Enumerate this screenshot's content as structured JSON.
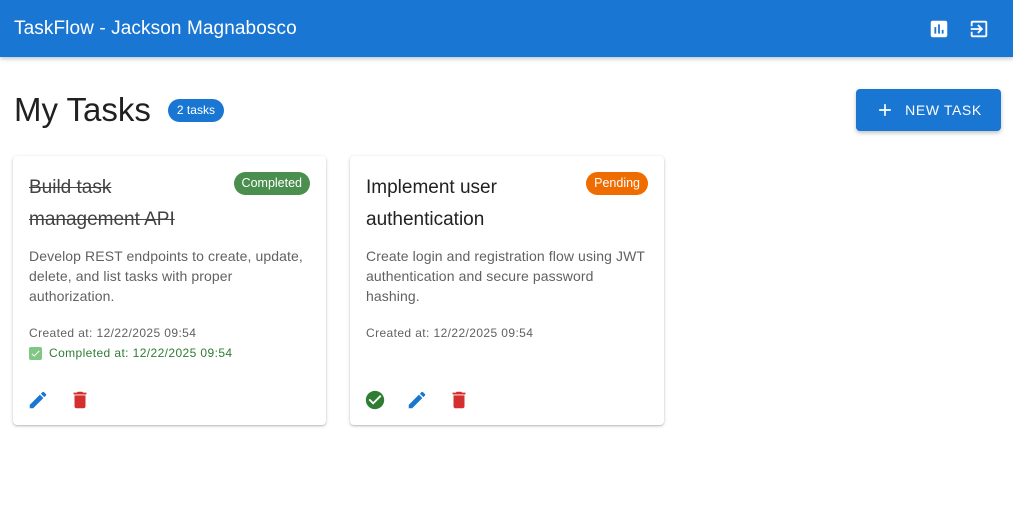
{
  "appbar": {
    "title": "TaskFlow - Jackson Magnabosco",
    "stats_icon": "bar-chart-icon",
    "logout_icon": "logout-icon"
  },
  "header": {
    "title": "My Tasks",
    "count_badge": "2 tasks",
    "new_task_label": "NEW TASK"
  },
  "tasks": [
    {
      "title": "Build task management API",
      "status": "Completed",
      "description": "Develop REST endpoints to create, update, delete, and list tasks with proper authorization.",
      "created_at": "Created at: 12/22/2025 09:54",
      "completed_at": "Completed at: 12/22/2025 09:54"
    },
    {
      "title": "Implement user authentication",
      "status": "Pending",
      "description": "Create login and registration flow using JWT authentication and secure password hashing.",
      "created_at": "Created at: 12/22/2025 09:54"
    }
  ],
  "colors": {
    "primary": "#1976d2",
    "completed": "#4a8f4e",
    "pending": "#ef6c00",
    "delete": "#d32f2f",
    "success": "#2e7d32"
  }
}
